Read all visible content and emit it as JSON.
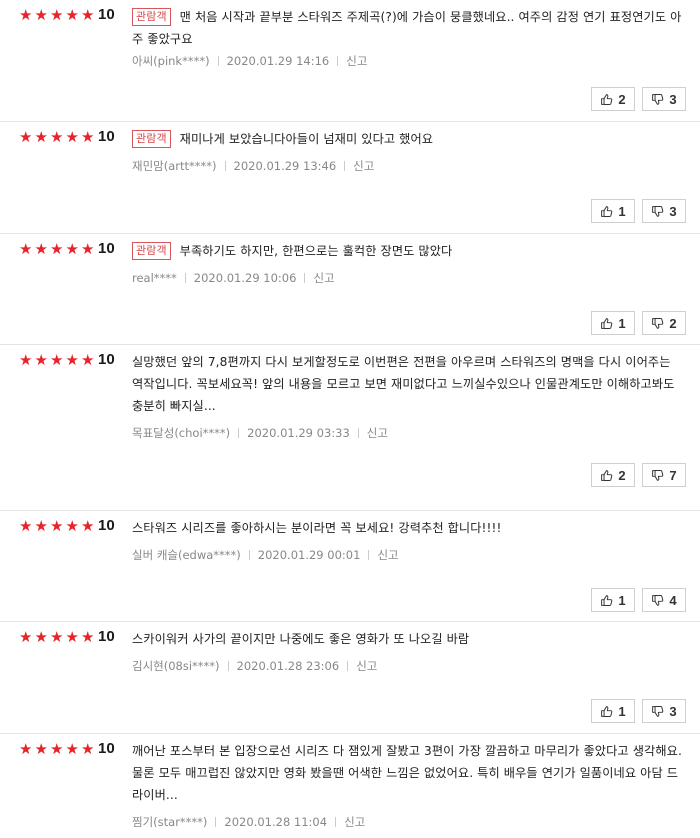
{
  "colors": {
    "star": "#e8242a",
    "badge": "#d8464c"
  },
  "reviews": [
    {
      "stars": 5,
      "score": "10",
      "badge": "관람객",
      "text": "맨 처음 시작과 끝부분 스타워즈 주제곡(?)에 가슴이 뭉클했네요.. 여주의 감정 연기 표정연기도 아주 좋았구요",
      "author": "아씨(pink****)",
      "date": "2020.01.29 14:16",
      "report": "신고",
      "up": "2",
      "down": "3"
    },
    {
      "stars": 5,
      "score": "10",
      "badge": "관람객",
      "text": "재미나게 보았습니다아들이 넘재미 있다고 했어요",
      "author": "재민맘(artt****)",
      "date": "2020.01.29 13:46",
      "report": "신고",
      "up": "1",
      "down": "3"
    },
    {
      "stars": 5,
      "score": "10",
      "badge": "관람객",
      "text": "부족하기도 하지만, 한편으로는 훌컥한 장면도 많았다",
      "author": "real****",
      "date": "2020.01.29 10:06",
      "report": "신고",
      "up": "1",
      "down": "2"
    },
    {
      "stars": 5,
      "score": "10",
      "badge": "",
      "text": "실망했던 앞의 7,8편까지 다시 보게할정도로 이번편은 전편을 아우르며 스타워즈의 명맥을 다시 이어주는 역작입니다. 꼭보세요꼭! 앞의 내용을 모르고 보면 재미없다고 느끼실수있으나 인물관계도만 이해하고봐도 충분히 빠지실...",
      "author": "목표달성(choi****)",
      "date": "2020.01.29 03:33",
      "report": "신고",
      "up": "2",
      "down": "7"
    },
    {
      "stars": 5,
      "score": "10",
      "badge": "",
      "text": "스타워즈 시리즈를 좋아하시는 분이라면 꼭 보세요! 강력추천 합니다!!!!",
      "author": "실버 캐슬(edwa****)",
      "date": "2020.01.29 00:01",
      "report": "신고",
      "up": "1",
      "down": "4"
    },
    {
      "stars": 5,
      "score": "10",
      "badge": "",
      "text": "스카이워커 사가의 끝이지만 나중에도 좋은 영화가 또 나오길 바람",
      "author": "김시현(08si****)",
      "date": "2020.01.28 23:06",
      "report": "신고",
      "up": "1",
      "down": "3"
    },
    {
      "stars": 5,
      "score": "10",
      "badge": "",
      "text": "깨어난 포스부터 본 입장으로선 시리즈 다 잼있게 잘봤고 3편이 가장 깔끔하고 마무리가 좋았다고 생각해요. 물론 모두 매끄럽진 않았지만 영화 봤을땐 어색한 느낌은 없었어요. 특히 배우들 연기가 일품이네요 아담 드라이버...",
      "author": "찜기(star****)",
      "date": "2020.01.28 11:04",
      "report": "신고",
      "up": "",
      "down": ""
    }
  ]
}
